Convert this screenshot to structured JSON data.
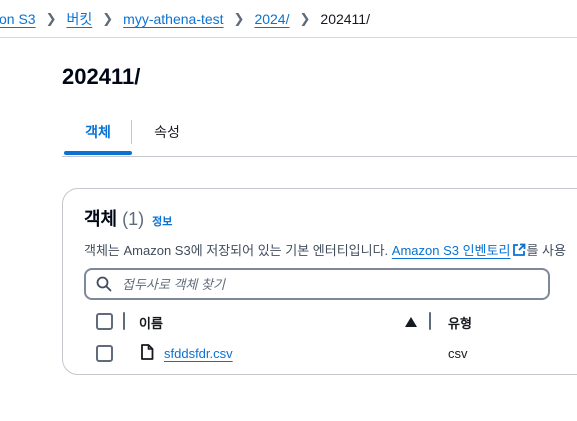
{
  "breadcrumb": {
    "items": [
      "zon S3",
      "버킷",
      "myy-athena-test",
      "2024/"
    ],
    "current": "202411/"
  },
  "page": {
    "title": "202411/"
  },
  "tabs": [
    {
      "label": "객체",
      "active": true
    },
    {
      "label": "속성",
      "active": false
    }
  ],
  "objects_panel": {
    "title": "객체",
    "count": "(1)",
    "info_label": "정보",
    "description_prefix": "객체는 Amazon S3에 저장되어 있는 기본 엔터티입니다.",
    "description_link": "Amazon S3 인벤토리",
    "description_suffix": "를 사용",
    "search": {
      "placeholder": "접두사로 객체 찾기",
      "value": ""
    },
    "columns": {
      "name": "이름",
      "type": "유형"
    },
    "rows": [
      {
        "name": "sfddsfdr.csv",
        "type": "csv"
      }
    ]
  },
  "colors": {
    "link": "#0972d3",
    "text": "#16191f",
    "border": "#c6c6cd"
  },
  "icons": [
    "chevron-right-icon",
    "external-link-icon",
    "search-icon",
    "sort-ascending-icon",
    "file-icon"
  ]
}
